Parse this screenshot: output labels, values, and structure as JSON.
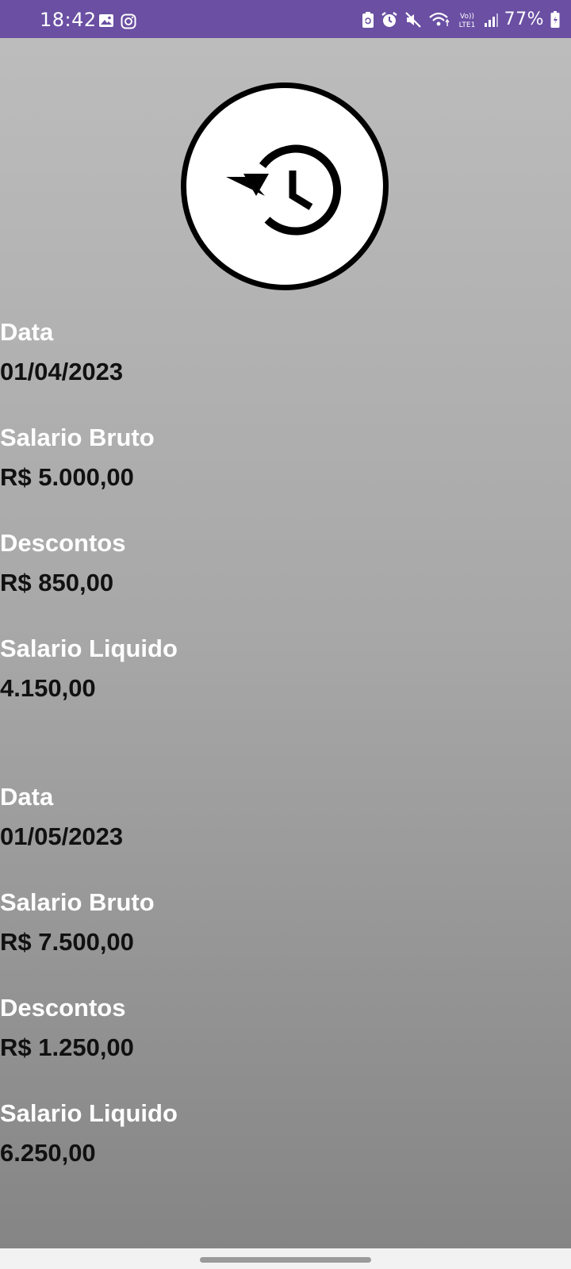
{
  "status_bar": {
    "time": "18:42",
    "battery_percent": "77%",
    "left_icons": [
      "gallery-icon",
      "instagram-icon"
    ],
    "right_icons": [
      "battery-saver-icon",
      "alarm-icon",
      "mute-icon",
      "wifi-icon",
      "volte-icon",
      "signal-icon",
      "battery-icon"
    ],
    "volte_label": "Vo))",
    "lte_label": "LTE1",
    "background_color": "#6a4fa3"
  },
  "header": {
    "icon": "history-icon"
  },
  "entries": [
    {
      "date_label": "Data",
      "date_value": "01/04/2023",
      "gross_label": "Salario Bruto",
      "gross_value": "R$ 5.000,00",
      "discounts_label": "Descontos",
      "discounts_value": "R$ 850,00",
      "net_label": "Salario Liquido",
      "net_value": "4.150,00"
    },
    {
      "date_label": "Data",
      "date_value": "01/05/2023",
      "gross_label": "Salario Bruto",
      "gross_value": "R$ 7.500,00",
      "discounts_label": "Descontos",
      "discounts_value": "R$ 1.250,00",
      "net_label": "Salario Liquido",
      "net_value": "6.250,00"
    }
  ],
  "colors": {
    "label_text": "#ffffff",
    "value_text": "#111111",
    "gradient_top": "#bcbcbc",
    "gradient_bottom": "#858585"
  }
}
